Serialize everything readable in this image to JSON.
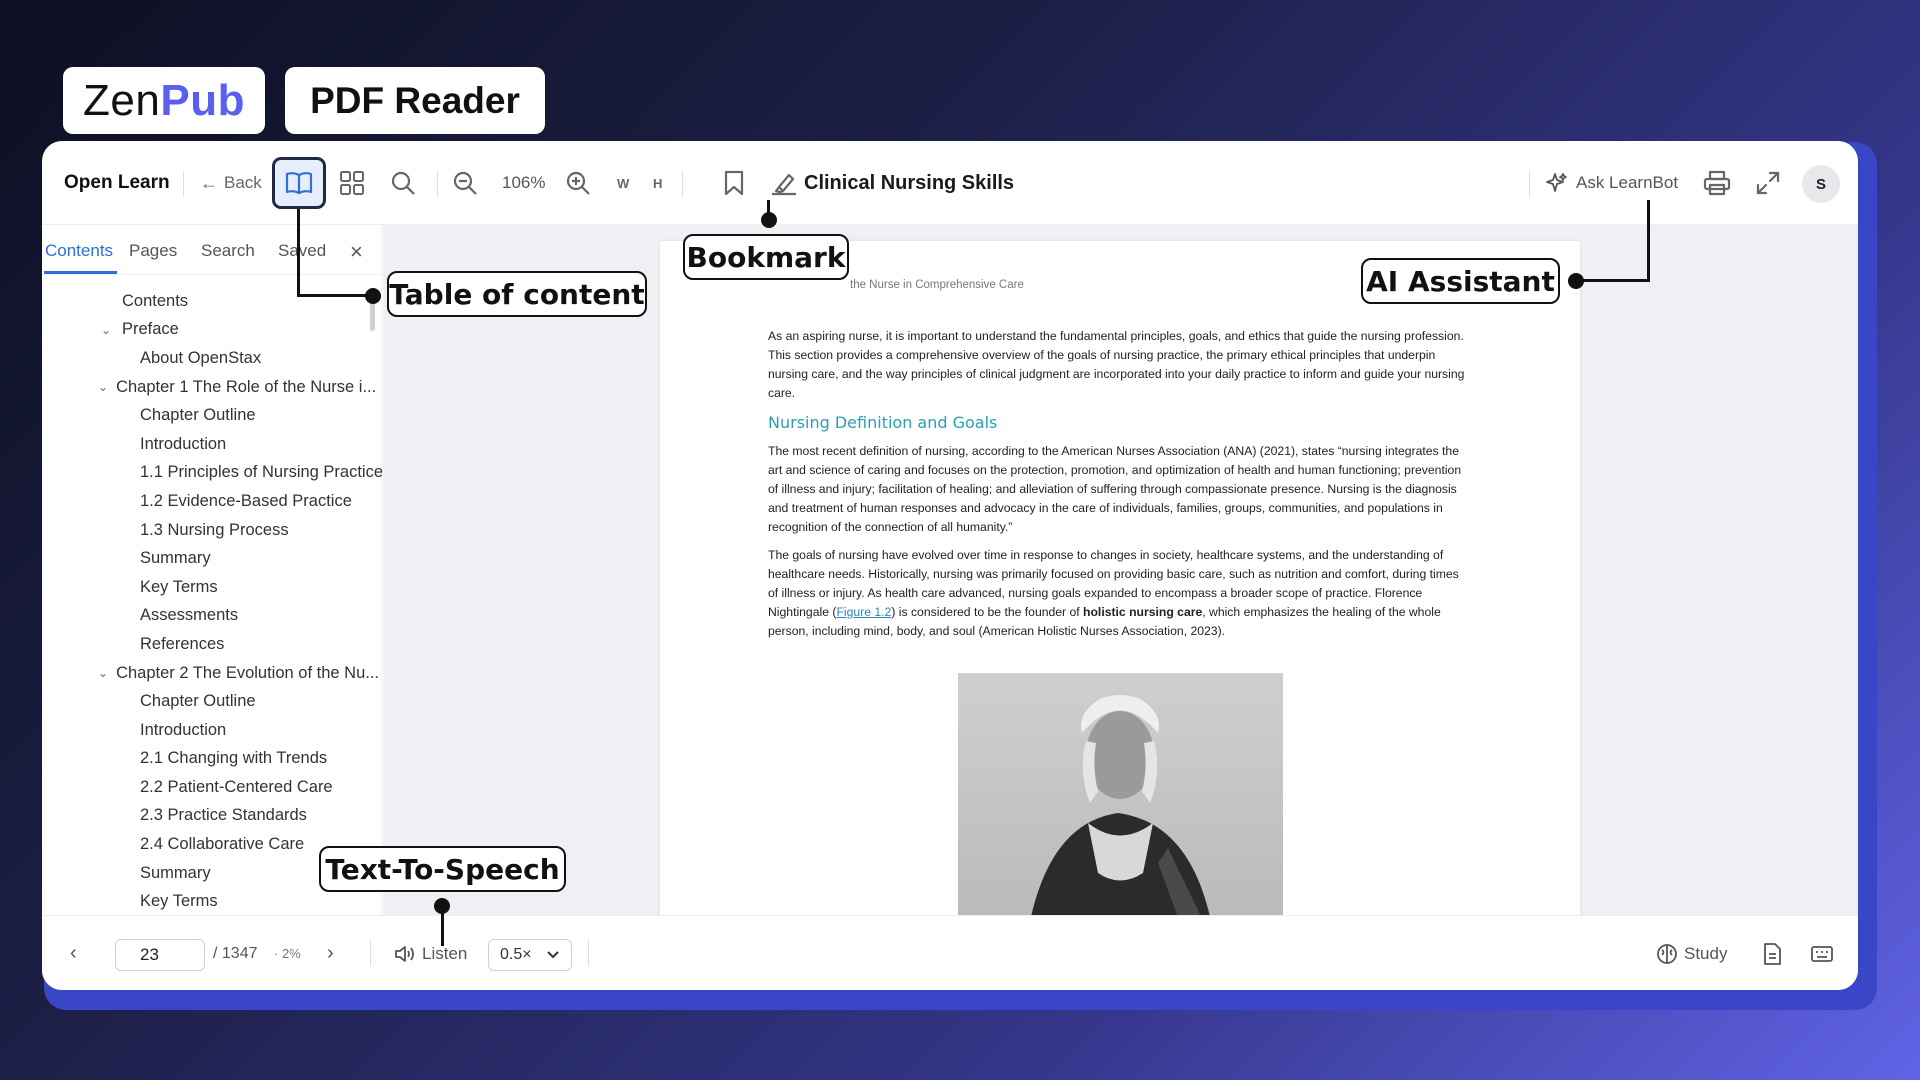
{
  "brand": {
    "zen": "Zen",
    "pub": "Pub",
    "product": "PDF Reader"
  },
  "toolbar": {
    "app_name": "Open Learn",
    "back_label": "Back",
    "zoom": "106%",
    "fit_width": "W",
    "fit_height": "H",
    "doc_title": "Clinical Nursing Skills",
    "ask_label": "Ask LearnBot",
    "avatar_initial": "S"
  },
  "sidebar": {
    "tabs": [
      "Contents",
      "Pages",
      "Search",
      "Saved"
    ],
    "close": "×",
    "items": [
      {
        "label": "Contents",
        "indent": 0,
        "chev": false
      },
      {
        "label": "Preface",
        "indent": 0,
        "chev": true
      },
      {
        "label": "About OpenStax",
        "indent": 1,
        "chev": false
      },
      {
        "label": "Chapter 1 The Role of the Nurse i...",
        "indent": 0,
        "chev": true
      },
      {
        "label": "Chapter Outline",
        "indent": 1,
        "chev": false
      },
      {
        "label": "Introduction",
        "indent": 1,
        "chev": false
      },
      {
        "label": "1.1 Principles of Nursing Practice",
        "indent": 1,
        "chev": false
      },
      {
        "label": "1.2 Evidence-Based Practice",
        "indent": 1,
        "chev": false
      },
      {
        "label": "1.3 Nursing Process",
        "indent": 1,
        "chev": false
      },
      {
        "label": "Summary",
        "indent": 1,
        "chev": false
      },
      {
        "label": "Key Terms",
        "indent": 1,
        "chev": false
      },
      {
        "label": "Assessments",
        "indent": 1,
        "chev": false
      },
      {
        "label": "References",
        "indent": 1,
        "chev": false
      },
      {
        "label": "Chapter 2 The Evolution of the Nu...",
        "indent": 0,
        "chev": true
      },
      {
        "label": "Chapter Outline",
        "indent": 1,
        "chev": false
      },
      {
        "label": "Introduction",
        "indent": 1,
        "chev": false
      },
      {
        "label": "2.1 Changing with Trends",
        "indent": 1,
        "chev": false
      },
      {
        "label": "2.2 Patient-Centered Care",
        "indent": 1,
        "chev": false
      },
      {
        "label": "2.3 Practice Standards",
        "indent": 1,
        "chev": false
      },
      {
        "label": "2.4 Collaborative Care",
        "indent": 1,
        "chev": false
      },
      {
        "label": "Summary",
        "indent": 1,
        "chev": false
      },
      {
        "label": "Key Terms",
        "indent": 1,
        "chev": false
      }
    ]
  },
  "page": {
    "header": "the Nurse in Comprehensive Care",
    "intro": "As an aspiring nurse, it is important to understand the fundamental principles, goals, and ethics that guide the nursing profession. This section provides a comprehensive overview of the goals of nursing practice, the primary ethical principles that underpin nursing care, and the way principles of clinical judgment are incorporated into your daily practice to inform and guide your nursing care.",
    "heading": "Nursing Definition and Goals",
    "para1": "The most recent definition of nursing, according to the American Nurses Association (ANA) (2021), states “nursing integrates the art and science of caring and focuses on the protection, promotion, and optimization of health and human functioning; prevention of illness and injury; facilitation of healing; and alleviation of suffering through compassionate presence. Nursing is the diagnosis and treatment of human responses and advocacy in the care of individuals, families, groups, communities, and populations in recognition of the connection of all humanity.”",
    "para2_a": "The goals of nursing have evolved over time in response to changes in society, healthcare systems, and the understanding of healthcare needs. Historically, nursing was primarily focused on providing basic care, such as nutrition and comfort, during times of illness or injury. As health care advanced, nursing goals expanded to encompass a broader scope of practice. Florence Nightingale (",
    "para2_link": "Figure 1.2",
    "para2_b": ") is considered to be the founder of ",
    "para2_bold": "holistic nursing care",
    "para2_c": ", which emphasizes the healing of the whole person, including mind, body, and soul (American Holistic Nurses Association, 2023)."
  },
  "bottombar": {
    "page_value": "23",
    "total": "/ 1347",
    "percent": "· 2%",
    "listen": "Listen",
    "speed": "0.5×",
    "study": "Study"
  },
  "callouts": {
    "toc": "Table of content",
    "bookmark": "Bookmark",
    "ai": "AI Assistant",
    "tts": "Text-To-Speech"
  }
}
